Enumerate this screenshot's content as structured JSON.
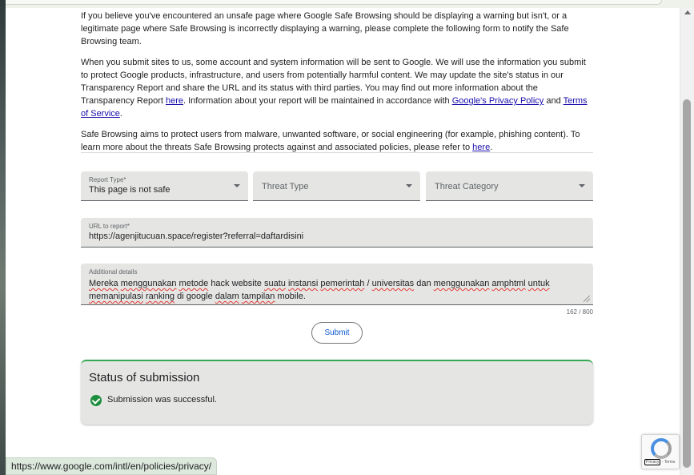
{
  "intro": {
    "p1": "If you believe you've encountered an unsafe page where Google Safe Browsing should be displaying a warning but isn't, or a legitimate page where Safe Browsing is incorrectly displaying a warning, please complete the following form to notify the Safe Browsing team.",
    "p2_before": "When you submit sites to us, some account and system information will be sent to Google. We will use the information you submit to protect Google products, infrastructure, and users from potentially harmful content. We may update the site's status in our Transparency Report and share the URL and its status with third parties. You may find out more information about the Transparency Report ",
    "p2_link_here": "here",
    "p2_middle": ". Information about your report will be maintained in accordance with ",
    "p2_link_privacy": "Google's Privacy Policy",
    "p2_and": " and ",
    "p2_link_terms": "Terms of Service",
    "p2_end": ".",
    "p3_before": "Safe Browsing aims to protect users from malware, unwanted software, or social engineering (for example, phishing content). To learn more about the threats Safe Browsing protects against and associated policies, please refer to ",
    "p3_link_here": "here",
    "p3_end": "."
  },
  "form": {
    "report_type": {
      "label": "Report Type*",
      "value": "This page is not safe"
    },
    "threat_type": {
      "placeholder": "Threat Type"
    },
    "threat_category": {
      "placeholder": "Threat Category"
    },
    "url": {
      "label": "URL to report*",
      "value": "https://agenjitucuan.space/register?referral=daftardisini"
    },
    "details": {
      "label": "Additional details",
      "line1_words": [
        "Mereka",
        "menggunakan",
        "metode",
        "hack",
        "website",
        "suatu",
        "instansi",
        "pemerintah",
        "/",
        "universitas",
        "dan",
        "menggunakan",
        "amphtml",
        "untuk"
      ],
      "line2_words": [
        "memanipulasi",
        "ranking",
        "di",
        "google",
        "dalam",
        "tampilan",
        "mobile."
      ]
    },
    "counter": "162 / 800",
    "submit_label": "Submit"
  },
  "status": {
    "title": "Status of submission",
    "message": "Submission was successful."
  },
  "status_bar": {
    "url": "https://www.google.com/intl/en/policies/privacy/"
  },
  "recaptcha": {
    "privacy": "Privacy",
    "separator": " - ",
    "terms": "Terms"
  },
  "colors": {
    "accent_blue": "#0b57d0",
    "success_green": "#1e8e3e",
    "link": "#1a0dab"
  }
}
